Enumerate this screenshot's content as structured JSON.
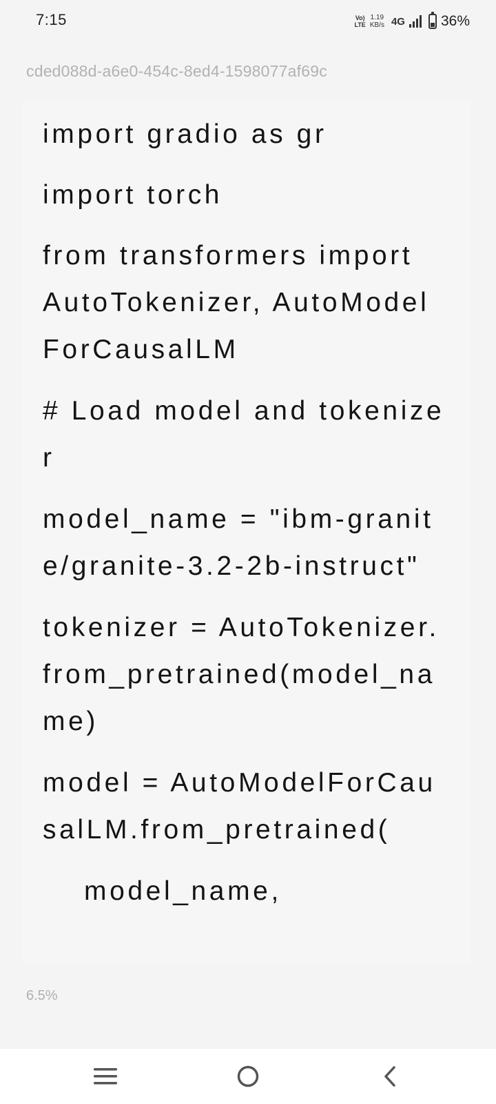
{
  "status_bar": {
    "time": "7:15",
    "volte_top": "Vo)",
    "volte_bottom": "LTE",
    "net_speed_value": "1.19",
    "net_speed_unit": "KB/s",
    "network_type": "4G",
    "battery_percent": "36%"
  },
  "document": {
    "id": "cded088d-a6e0-454c-8ed4-1598077af69c",
    "code_lines": [
      "import gradio as gr",
      "import torch",
      "from transformers import",
      "AutoTokenizer, AutoModel",
      "ForCausalLM",
      "# Load model and tokenize",
      "r",
      "model_name = \"ibm-granit",
      "e/granite-3.2-2b-instruct\"",
      "tokenizer = AutoTokenizer.",
      "from_pretrained(model_na",
      "me)",
      "model = AutoModelForCau",
      "salLM.from_pretrained(",
      "model_name,"
    ]
  },
  "reading_progress": "6.5%",
  "nav": {
    "menu_icon": "menu-icon",
    "home_icon": "home-icon",
    "back_icon": "back-icon"
  },
  "colors": {
    "background": "#f4f4f4",
    "card": "#f6f6f6",
    "text": "#141414",
    "muted": "#b2b2b2"
  }
}
